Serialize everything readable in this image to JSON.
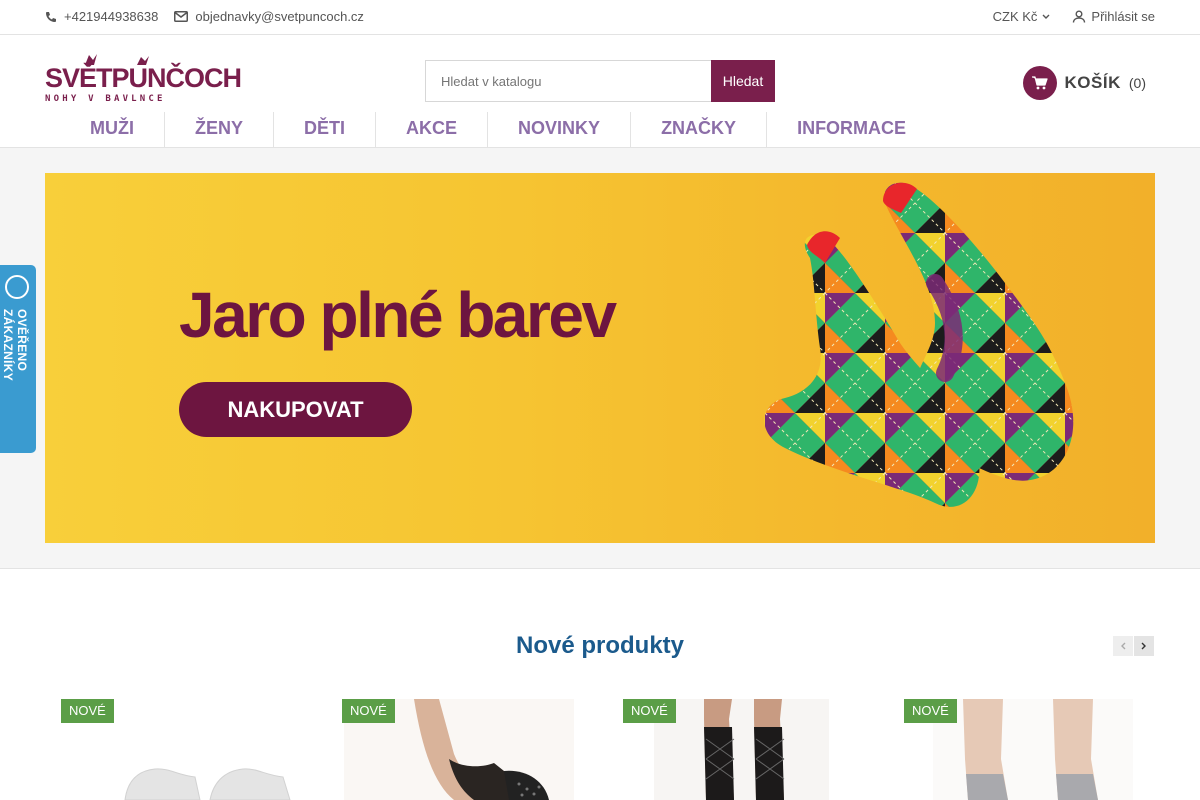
{
  "topbar": {
    "phone": "+421944938638",
    "email": "objednavky@svetpuncoch.cz",
    "currency": "CZK Kč",
    "login": "Přihlásit se"
  },
  "logo": {
    "brand": "SVĚTPUNČOCH",
    "tagline": "NOHY V BAVLNCE"
  },
  "search": {
    "placeholder": "Hledat v katalogu",
    "button": "Hledat"
  },
  "cart": {
    "label": "KOŠÍK",
    "count": "(0)"
  },
  "nav": [
    "MUŽI",
    "ŽENY",
    "DĚTI",
    "AKCE",
    "NOVINKY",
    "ZNAČKY",
    "INFORMACE"
  ],
  "banner": {
    "headline": "Jaro plné barev",
    "cta": "NAKUPOVAT"
  },
  "verified": {
    "text": "OVĚŘENO ZÁKAZNÍKY"
  },
  "new_products": {
    "title": "Nové produkty",
    "flag": "NOVÉ",
    "items": [
      {
        "flag": "NOVÉ",
        "image": "white-ankle-socks"
      },
      {
        "flag": "NOVÉ",
        "image": "black-footie-socks"
      },
      {
        "flag": "NOVÉ",
        "image": "black-patterned-knee-highs"
      },
      {
        "flag": "NOVÉ",
        "image": "grey-ankle-socks"
      }
    ]
  },
  "colors": {
    "brand": "#7a1f4c",
    "nav": "#8c6ea8",
    "title": "#1b5a8c",
    "flag": "#5b9e47",
    "banner": "#f6c532",
    "verified": "#3a9bd0"
  },
  "icons": {
    "phone": "phone-icon",
    "email": "envelope-icon",
    "currency_caret": "chevron-down-icon",
    "user": "user-icon",
    "cart": "cart-icon",
    "prev": "chevron-left-icon",
    "next": "chevron-right-icon"
  }
}
